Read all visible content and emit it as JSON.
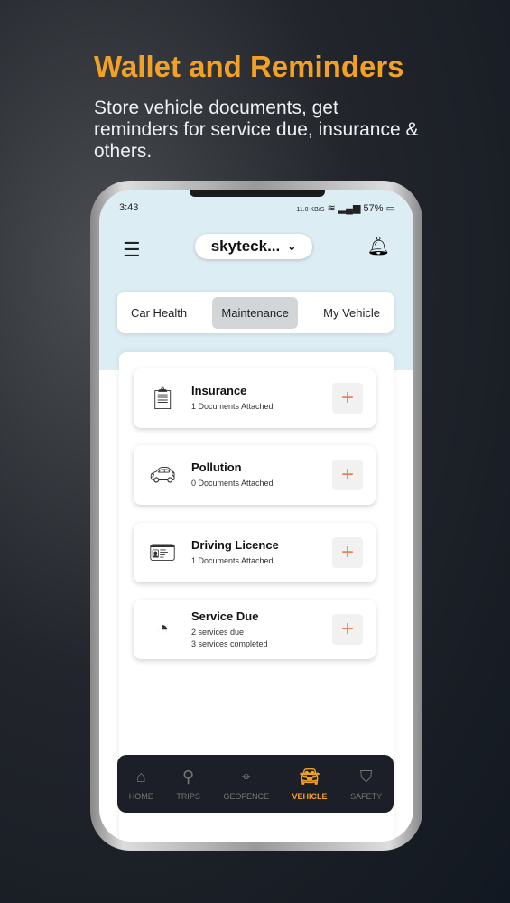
{
  "promo": {
    "title": "Wallet and Reminders",
    "subtitle": "Store vehicle documents, get reminders for service due, insurance & others."
  },
  "status": {
    "time": "3:43",
    "speed": "11.0 KB/S",
    "battery": "57%"
  },
  "header": {
    "vehicle": "skyteck..."
  },
  "tabs": [
    {
      "label": "Car Health"
    },
    {
      "label": "Maintenance",
      "active": true
    },
    {
      "label": "My Vehicle"
    }
  ],
  "cards": [
    {
      "title": "Insurance",
      "lines": [
        "1 Documents Attached"
      ],
      "icon": "clipboard-shield-icon"
    },
    {
      "title": "Pollution",
      "lines": [
        "0 Documents Attached"
      ],
      "icon": "car-smoke-icon"
    },
    {
      "title": "Driving Licence",
      "lines": [
        "1 Documents Attached"
      ],
      "icon": "id-card-icon"
    },
    {
      "title": "Service Due",
      "lines": [
        "2 services due",
        "3 services completed"
      ],
      "icon": "speedometer-icon"
    }
  ],
  "nav": [
    {
      "label": "HOME"
    },
    {
      "label": "TRIPS"
    },
    {
      "label": "GEOFENCE"
    },
    {
      "label": "VEHICLE",
      "active": true
    },
    {
      "label": "SAFETY"
    }
  ],
  "colors": {
    "accent": "#f3a125",
    "plus": "#e5855a",
    "nav_bg": "#1c1f27"
  }
}
